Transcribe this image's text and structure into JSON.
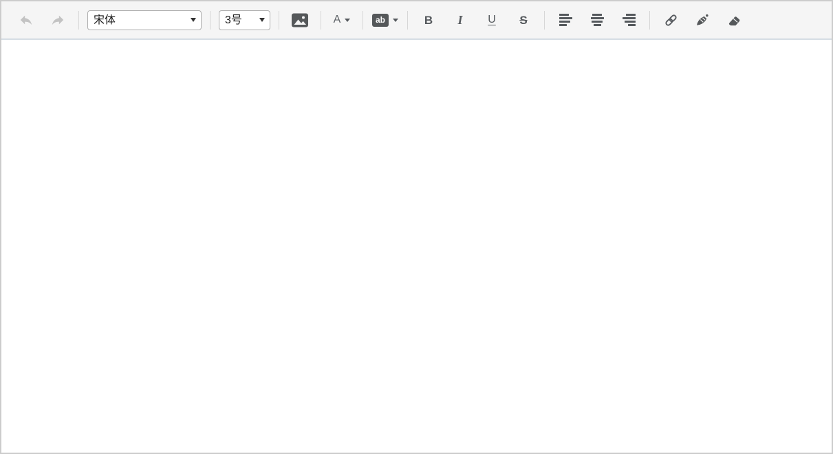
{
  "editor": {
    "toolbar": {
      "font_family": {
        "value": "宋体"
      },
      "font_size": {
        "value": "3号"
      },
      "labels": {
        "font_color": "A",
        "highlight": "ab",
        "bold": "B",
        "italic": "I",
        "underline": "U",
        "strikethrough": "S"
      },
      "icon_names": [
        "undo-icon",
        "redo-icon",
        "caret-down-icon",
        "image-icon",
        "align-left-icon",
        "align-center-icon",
        "align-right-icon",
        "link-icon",
        "brush-icon",
        "eraser-icon"
      ]
    },
    "content": {
      "text": ""
    },
    "colors": {
      "toolbar_bg": "#f5f5f5",
      "toolbar_rule": "#d5dde4",
      "outer_border": "#cccccc",
      "icon_gray": "#55595d",
      "disabled_gray": "#c3c3c3",
      "dark_chip": "#55585a"
    }
  }
}
